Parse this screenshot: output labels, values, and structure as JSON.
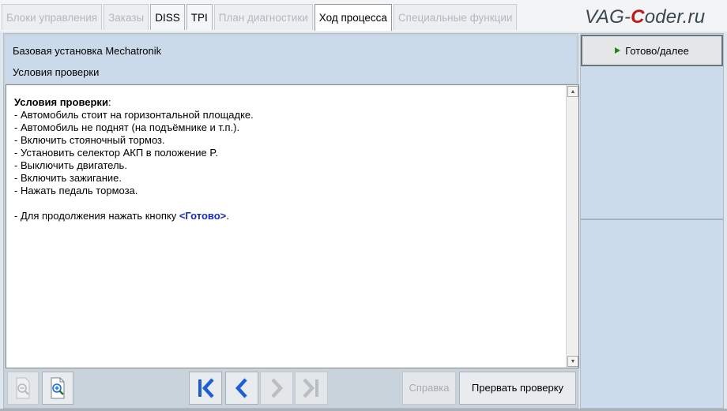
{
  "tabs": [
    {
      "label": "Блоки управления",
      "state": "disabled"
    },
    {
      "label": "Заказы",
      "state": "disabled"
    },
    {
      "label": "DISS",
      "state": "enabled"
    },
    {
      "label": "TPI",
      "state": "enabled"
    },
    {
      "label": "План диагностики",
      "state": "disabled"
    },
    {
      "label": "Ход процесса",
      "state": "active"
    },
    {
      "label": "Специальные функции",
      "state": "disabled"
    }
  ],
  "watermark": {
    "pre": "VAG-",
    "highlight": "C",
    "post": "oder.ru"
  },
  "header": {
    "title": "Базовая установка Mechatronik",
    "subtitle": "Условия проверки"
  },
  "content": {
    "heading": "Условия проверки",
    "heading_suffix": ":",
    "lines": [
      "- Автомобиль стоит на горизонтальной площадке.",
      "- Автомобиль не поднят (на подъёмнике и т.п.).",
      "- Включить стояночный тормоз.",
      "- Установить селектор АКП в положение P.",
      "- Выключить двигатель.",
      "- Включить зажигание.",
      "- Нажать педаль тормоза."
    ],
    "final_prefix": "- Для продолжения нажать кнопку ",
    "final_button_ref": "<Готово>",
    "final_suffix": "."
  },
  "toolbar": {
    "help_label": "Справка",
    "abort_label": "Прервать проверку"
  },
  "right_panel": {
    "done_label": "Готово/далее"
  },
  "colors": {
    "accent_blue": "#1a2ab8",
    "play_green": "#1b8a1b",
    "nav_blue": "#1f5fd1"
  }
}
